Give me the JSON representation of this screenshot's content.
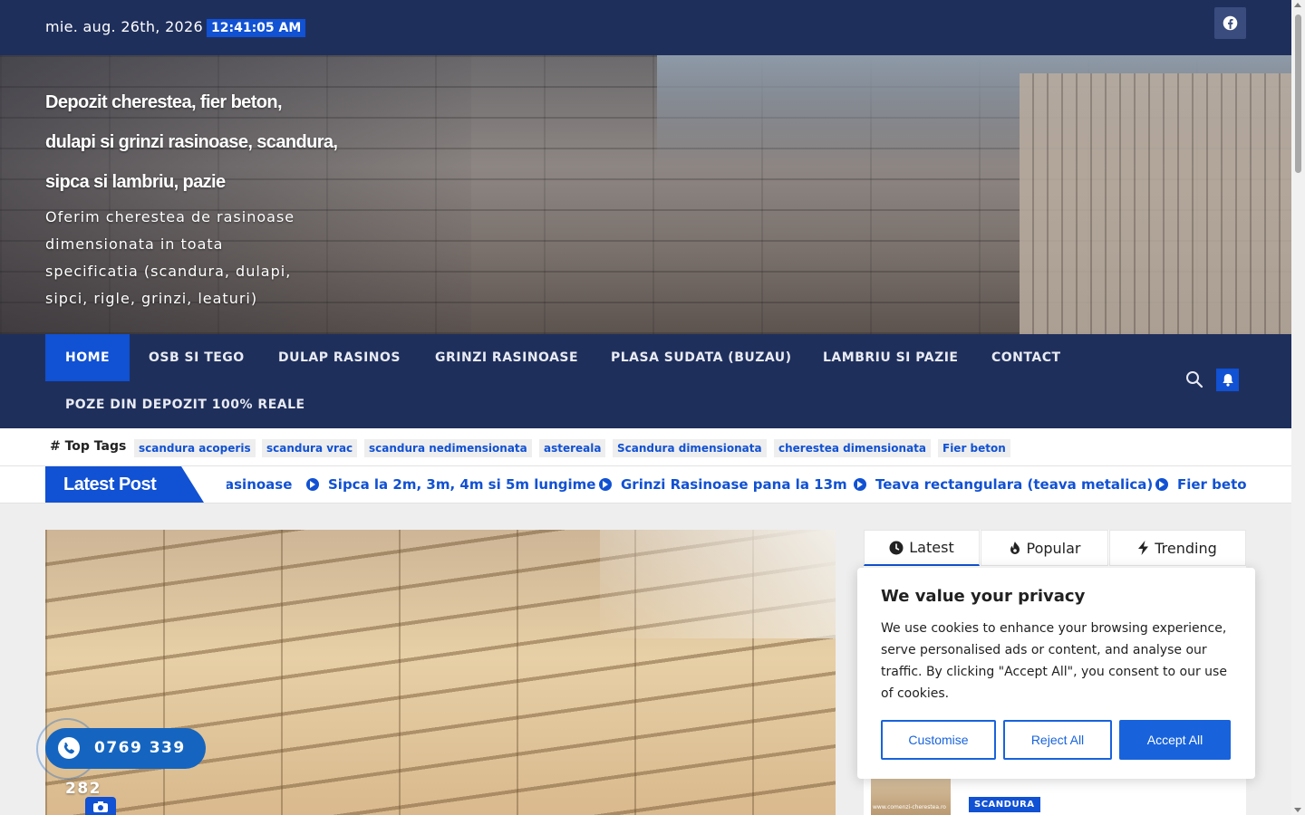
{
  "topbar": {
    "date": "mie. aug. 26th, 2026",
    "time": "12:41:05 AM",
    "social": "facebook-icon"
  },
  "header": {
    "title_lines": [
      "Depozit cherestea, fier beton,",
      "dulapi si grinzi rasinoase, scandura,",
      "sipca si lambriu, pazie"
    ],
    "description": "Oferim cherestea de rasinoase dimensionata in toata specificatia (scandura, dulapi, sipci, rigle, grinzi, leaturi)"
  },
  "nav": {
    "items": [
      "HOME",
      "OSB SI TEGO",
      "DULAP RASINOS",
      "GRINZI RASINOASE",
      "PLASA SUDATA (BUZAU)",
      "LAMBRIU SI PAZIE",
      "CONTACT",
      "POZE DIN DEPOZIT 100% REALE"
    ],
    "active": "HOME"
  },
  "tags": {
    "label": "# Top Tags",
    "items": [
      "scandura acoperis",
      "scandura vrac",
      "scandura nedimensionata",
      "astereala",
      "Scandura dimensionata",
      "cherestea dimensionata",
      "Fier beton"
    ]
  },
  "ticker": {
    "label": "Latest Post",
    "items": [
      "asinoase",
      "Sipca la 2m, 3m, 4m si 5m lungime",
      "Grinzi Rasinoase pana la 13m",
      "Teava rectangulara (teava metalica)",
      "Fier beton"
    ]
  },
  "phone": {
    "number_line1": "0769 339",
    "number_line2": "282"
  },
  "sidebar": {
    "tabs": [
      "Latest",
      "Popular",
      "Trending"
    ],
    "active_tab": "Latest",
    "post_category": "SCANDURA",
    "thumb_watermark": "www.comenzi-cherestea.ro"
  },
  "cookie": {
    "title": "We value your privacy",
    "text": "We use cookies to enhance your browsing experience, serve personalised ads or content, and analyse our traffic. By clicking \"Accept All\", you consent to our use of cookies.",
    "buttons": [
      "Customise",
      "Reject All",
      "Accept All"
    ]
  },
  "colors": {
    "navy": "#1f2f5c",
    "accent": "#1151d3",
    "cookie_accent": "#1863dc"
  }
}
